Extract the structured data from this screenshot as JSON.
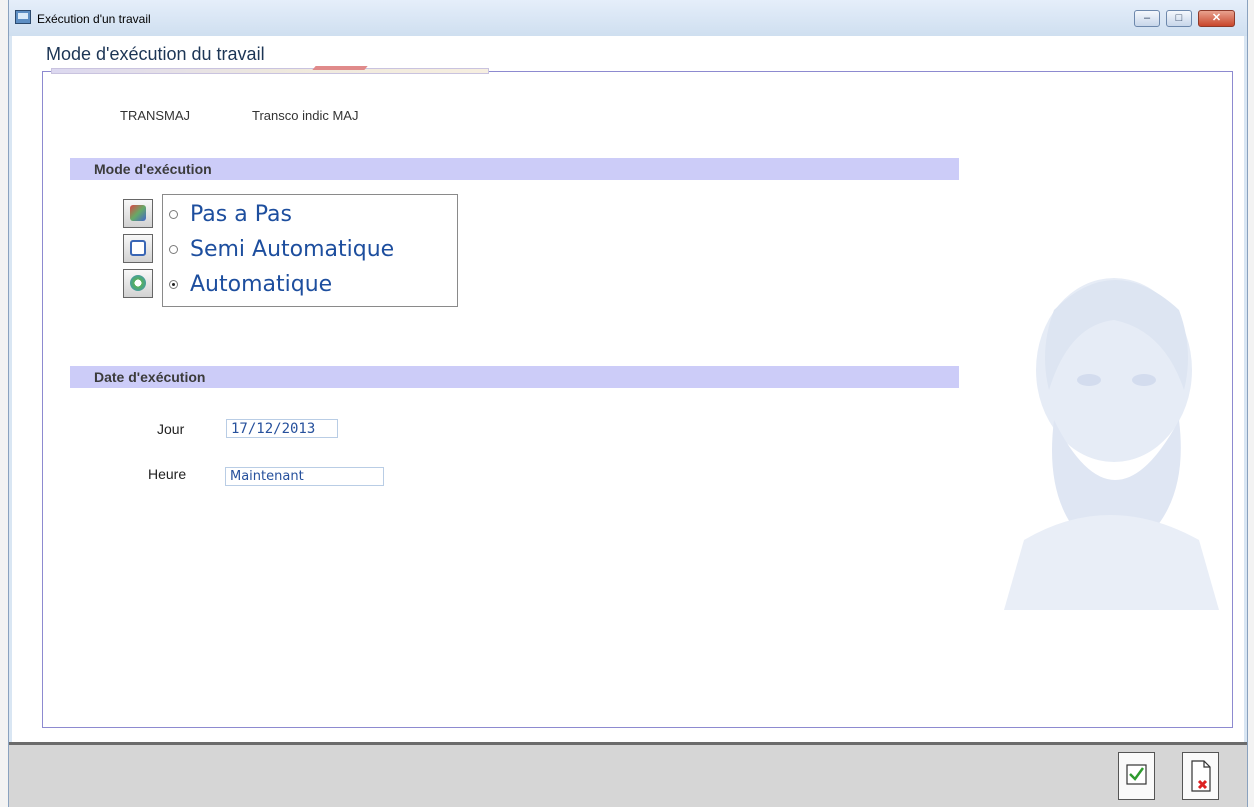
{
  "window": {
    "title": "Exécution d'un travail",
    "minimize_symbol": "–",
    "maximize_symbol": "□",
    "close_symbol": "✕"
  },
  "panel": {
    "title": "Mode d'exécution du travail"
  },
  "job": {
    "code": "TRANSMAJ",
    "description": "Transco indic MAJ"
  },
  "mode_section": {
    "title": "Mode d'exécution",
    "options": [
      {
        "label": "Pas a Pas",
        "selected": false,
        "icon": "step-icon"
      },
      {
        "label": "Semi Automatique",
        "selected": false,
        "icon": "semi-auto-icon"
      },
      {
        "label": "Automatique",
        "selected": true,
        "icon": "auto-icon"
      }
    ]
  },
  "date_section": {
    "title": "Date d'exécution",
    "day_label": "Jour",
    "day_value": "17/12/2013",
    "hour_label": "Heure",
    "hour_value": "Maintenant"
  },
  "actions": {
    "ok_icon": "validate-icon",
    "cancel_icon": "cancel-icon"
  },
  "colors": {
    "section_bar": "#ccccf8",
    "radio_text": "#1d4e9e",
    "panel_border": "#8d8ad0"
  }
}
